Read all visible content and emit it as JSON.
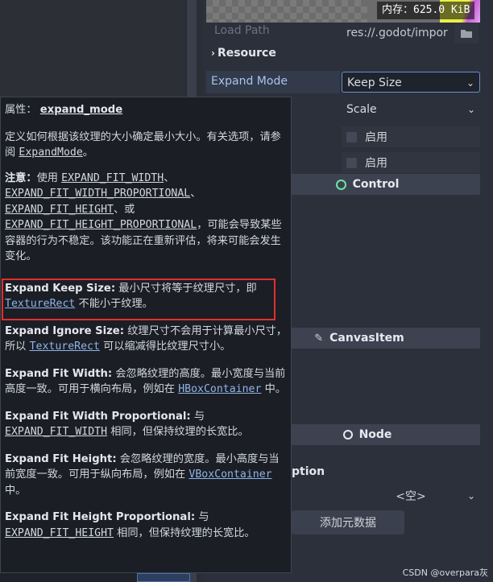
{
  "preview": {
    "memory_label": "内存：625.0 KiB"
  },
  "load_path": {
    "label": "Load Path",
    "value": "res://.godot/impor"
  },
  "resource_section": "Resource",
  "expand_mode": {
    "label": "Expand Mode",
    "value": "Keep Size"
  },
  "stretch_mode": {
    "value": "Scale"
  },
  "flip_h": {
    "checkbox_label": "启用"
  },
  "flip_v": {
    "checkbox_label": "启用"
  },
  "categories": {
    "control": "Control",
    "canvas_item": "CanvasItem",
    "node": "Node"
  },
  "metadata": {
    "section_label": "ption",
    "value": "<空>",
    "add_button": "添加元数据"
  },
  "tooltip": {
    "property_prefix": "属性：",
    "property_name": "expand_mode",
    "desc_part1": "定义如何根据该纹理的大小确定最小大小。有关选项，请参阅 ",
    "desc_link": "ExpandMode",
    "desc_end": "。",
    "note_label": "注意：",
    "note_use": "使用 ",
    "note_c1": "EXPAND_FIT_WIDTH",
    "note_sep1": "、",
    "note_c2": "EXPAND_FIT_WIDTH_PROPORTIONAL",
    "note_sep2": "、",
    "note_c3": "EXPAND_FIT_HEIGHT",
    "note_sep3": "、或",
    "note_c4": "EXPAND_FIT_HEIGHT_PROPORTIONAL",
    "note_rest": "，可能会导致某些容器的行为不稳定。该功能正在重新评估，将来可能会发生变化。",
    "keep_size_title": "Expand Keep Size:",
    "keep_size_text1": " 最小尺寸将等于纹理尺寸，即 ",
    "keep_size_link": "TextureRect",
    "keep_size_text2": " 不能小于纹理。",
    "ignore_size_title": "Expand Ignore Size:",
    "ignore_size_text1": " 纹理尺寸不会用于计算最小尺寸，所以 ",
    "ignore_size_link": "TextureRect",
    "ignore_size_text2": " 可以缩减得比纹理尺寸小。",
    "fit_width_title": "Expand Fit Width:",
    "fit_width_text1": " 会忽略纹理的高度。最小宽度与当前高度一致。可用于横向布局，例如在 ",
    "fit_width_link": "HBoxContainer",
    "fit_width_text2": " 中。",
    "fit_width_prop_title": "Expand Fit Width Proportional:",
    "fit_width_prop_text1": " 与 ",
    "fit_width_prop_code": "EXPAND_FIT_WIDTH",
    "fit_width_prop_text2": " 相同，但保持纹理的长宽比。",
    "fit_height_title": "Expand Fit Height:",
    "fit_height_text1": " 会忽略纹理的宽度。最小高度与当前宽度一致。可用于纵向布局，例如在 ",
    "fit_height_link": "VBoxContainer",
    "fit_height_text2": " 中。",
    "fit_height_prop_title": "Expand Fit Height Proportional:",
    "fit_height_prop_text1": " 与 ",
    "fit_height_prop_code": "EXPAND_FIT_HEIGHT",
    "fit_height_prop_text2": " 相同，但保持纹理的长宽比。"
  },
  "watermark": "CSDN @overpara灰",
  "colors": {
    "highlight": "#e0302e",
    "link": "#8fb4e8",
    "accent_circle": "#6fe3a1"
  }
}
